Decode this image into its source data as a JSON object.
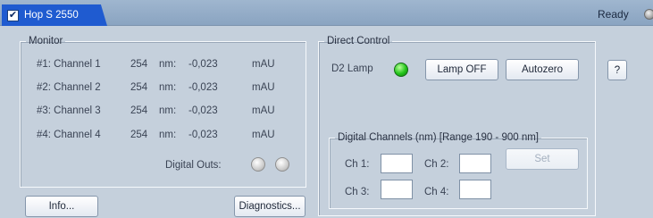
{
  "window": {
    "tab_title": "Hop S 2550",
    "status": "Ready"
  },
  "monitor": {
    "legend": "Monitor",
    "channels": [
      {
        "label": "#1: Channel 1",
        "wavelength": "254",
        "unit_wl": "nm:",
        "value": "-0,023",
        "unit": "mAU"
      },
      {
        "label": "#2: Channel 2",
        "wavelength": "254",
        "unit_wl": "nm:",
        "value": "-0,023",
        "unit": "mAU"
      },
      {
        "label": "#3: Channel 3",
        "wavelength": "254",
        "unit_wl": "nm:",
        "value": "-0,023",
        "unit": "mAU"
      },
      {
        "label": "#4: Channel 4",
        "wavelength": "254",
        "unit_wl": "nm:",
        "value": "-0,023",
        "unit": "mAU"
      }
    ],
    "digital_outs_label": "Digital Outs:"
  },
  "buttons": {
    "info": "Info...",
    "diagnostics": "Diagnostics...",
    "lamp_off": "Lamp OFF",
    "autozero": "Autozero",
    "help": "?",
    "set": "Set"
  },
  "direct_control": {
    "legend": "Direct Control",
    "d2_lamp_label": "D2 Lamp",
    "digital_channels": {
      "legend": "Digital Channels (nm) [Range 190 - 900 nm]",
      "ch1": "Ch 1:",
      "ch2": "Ch 2:",
      "ch3": "Ch 3:",
      "ch4": "Ch 4:",
      "values": {
        "ch1": "",
        "ch2": "",
        "ch3": "",
        "ch4": ""
      }
    }
  },
  "colors": {
    "tab_active": "#1f5bd0",
    "lamp_on": "#22c41a",
    "background": "#c5d0dc"
  }
}
